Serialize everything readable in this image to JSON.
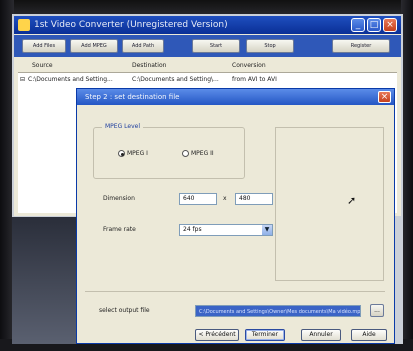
{
  "main_window": {
    "title": "1st Video Converter (Unregistered Version)",
    "toolbar": [
      "Add Files",
      "Add MPEG",
      "Add Path",
      "Start",
      "Stop",
      "Register"
    ],
    "columns": {
      "source": "Source",
      "destination": "Destination",
      "conversion": "Conversion"
    },
    "row": {
      "source": "C:\\Documents and Setting...",
      "destination": "C:\\Documents and Setting\\...",
      "conversion": "from AVI to AVI"
    }
  },
  "dialog": {
    "title": "Step 2 : set destination file",
    "mpeg_level": {
      "label": "MPEG Level",
      "options": [
        "MPEG I",
        "MPEG II"
      ],
      "selected": "MPEG I"
    },
    "dimension": {
      "label": "Dimension",
      "width": "640",
      "separator": "x",
      "height": "480"
    },
    "frame_rate": {
      "label": "Frame rate",
      "value": "24 fps"
    },
    "output": {
      "label": "select output file",
      "path": "C:\\Documents and Settings\\Owner\\Mes documents\\Ma vidéo.mpg",
      "browse": "..."
    },
    "buttons": {
      "back": "< Précédent",
      "finish": "Terminer",
      "cancel": "Annuler",
      "help": "Aide"
    }
  }
}
